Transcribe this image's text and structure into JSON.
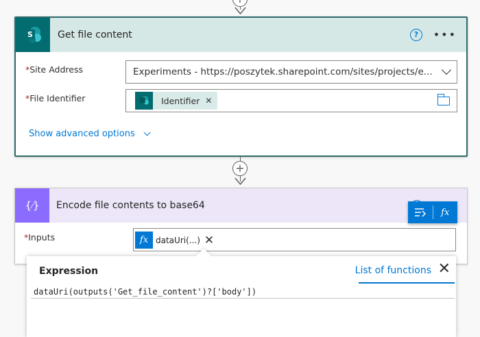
{
  "step1": {
    "title": "Get file content",
    "icon_letter": "S",
    "fields": [
      {
        "label": "Site Address",
        "value": "Experiments - https://poszytek.sharepoint.com/sites/projects/e..."
      },
      {
        "label": "File Identifier",
        "token": "Identifier"
      }
    ],
    "advanced_label": "Show advanced options"
  },
  "step2": {
    "title": "Encode file contents to base64",
    "icon_glyph": "{⁄}",
    "inputs_label": "Inputs",
    "fx_token": "dataUri(...)"
  },
  "dynamic_popup": {
    "fx_label": "fx"
  },
  "expression_panel": {
    "tab_label": "Expression",
    "list_label": "List of functions",
    "value": "dataUri(outputs('Get_file_content')?['body'])"
  },
  "colors": {
    "sharepoint_teal": "#036c70",
    "data_ops_purple": "#8c6cff",
    "accent_blue": "#0078d4"
  }
}
